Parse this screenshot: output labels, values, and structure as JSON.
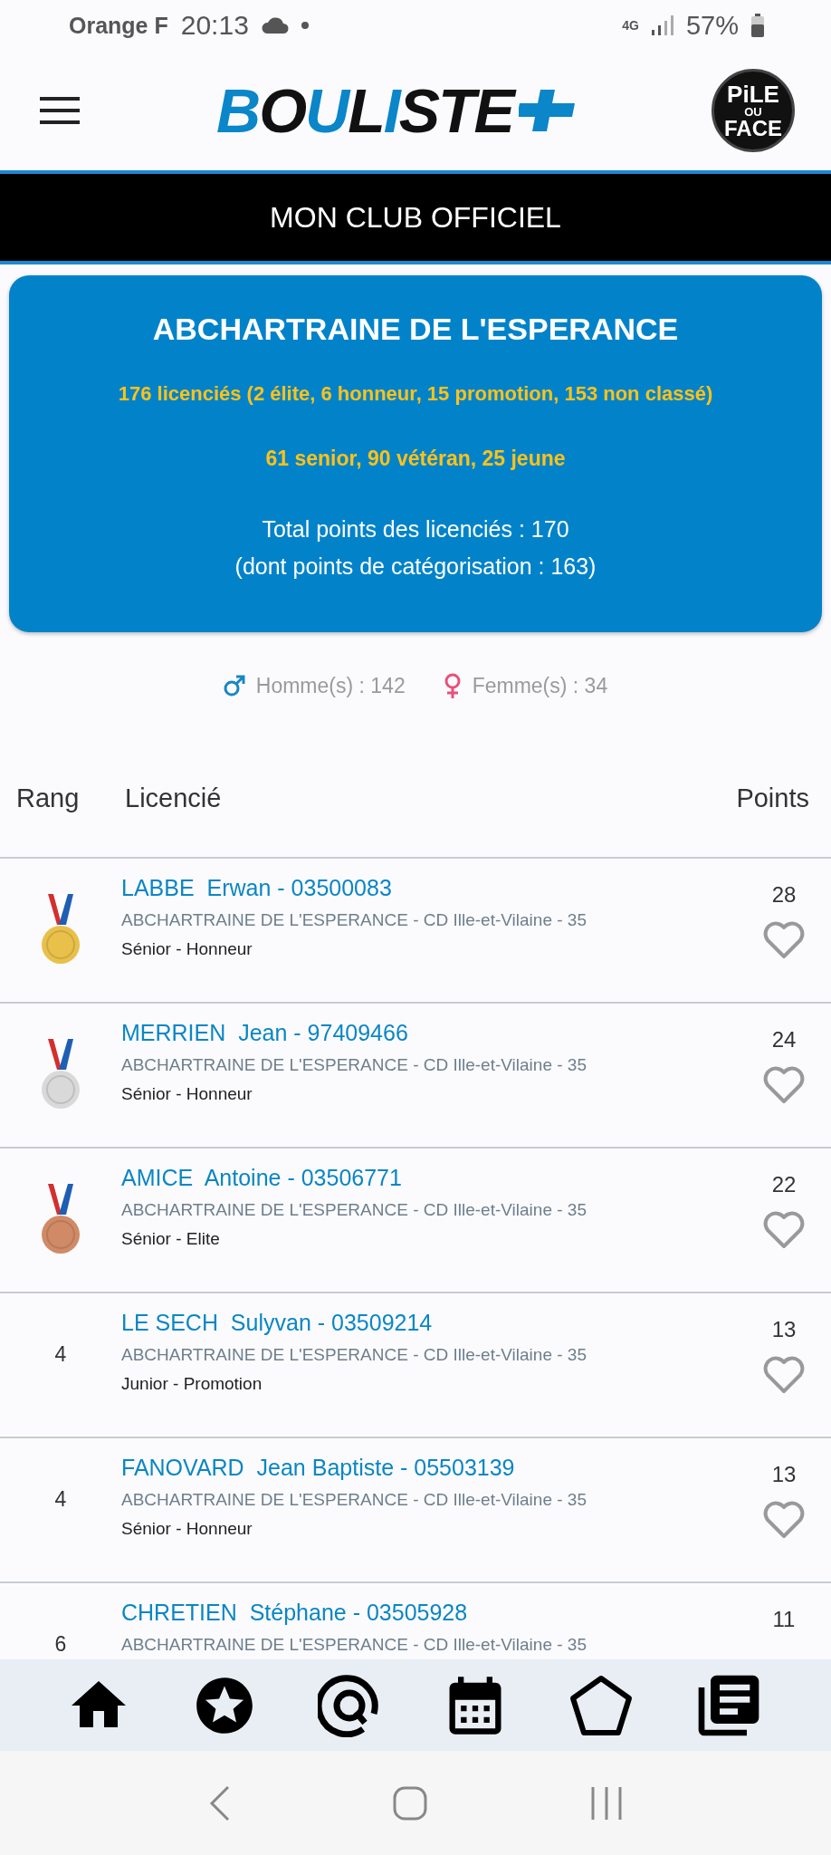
{
  "status_bar": {
    "carrier": "Orange F",
    "time": "20:13",
    "network": "4G",
    "battery": "57%"
  },
  "header": {
    "logo": "BOULISTE",
    "partner_logo": [
      "PiLE",
      "OU",
      "FACE"
    ]
  },
  "title_bar": "MON CLUB OFFICIEL",
  "club": {
    "name": "ABCHARTRAINE DE L'ESPERANCE",
    "licences": "176 licenciés (2 élite, 6 honneur, 15 promotion, 153 non classé)",
    "ages": "61 senior, 90 vétéran, 25 jeune",
    "total_points": "Total points des licenciés : 170",
    "categorisation_points": "(dont points de catégorisation : 163)"
  },
  "gender": {
    "men": "Homme(s) : 142",
    "women": "Femme(s) : 34"
  },
  "table": {
    "columns": [
      "Rang",
      "Licencié",
      "Points"
    ],
    "rows": [
      {
        "kind": "medal",
        "color": "#e8c04a",
        "name": "LABBE  Erwan - 03500083",
        "club": "ABCHARTRAINE DE L'ESPERANCE - CD Ille-et-Vilaine - 35",
        "category": "Sénior - Honneur",
        "points": "28",
        "favorite": false
      },
      {
        "kind": "medal",
        "color": "#d9d9d9",
        "name": "MERRIEN  Jean - 97409466",
        "club": "ABCHARTRAINE DE L'ESPERANCE - CD Ille-et-Vilaine - 35",
        "category": "Sénior - Honneur",
        "points": "24",
        "favorite": false
      },
      {
        "kind": "medal",
        "color": "#d08a66",
        "name": "AMICE  Antoine - 03506771",
        "club": "ABCHARTRAINE DE L'ESPERANCE - CD Ille-et-Vilaine - 35",
        "category": "Sénior - Elite",
        "points": "22",
        "favorite": false
      },
      {
        "kind": "rank",
        "rank": "4",
        "name": "LE SECH  Sulyvan - 03509214",
        "club": "ABCHARTRAINE DE L'ESPERANCE - CD Ille-et-Vilaine - 35",
        "category": "Junior - Promotion",
        "points": "13",
        "favorite": false
      },
      {
        "kind": "rank",
        "rank": "4",
        "name": "FANOVARD  Jean Baptiste - 05503139",
        "club": "ABCHARTRAINE DE L'ESPERANCE - CD Ille-et-Vilaine - 35",
        "category": "Sénior - Honneur",
        "points": "13",
        "favorite": false
      },
      {
        "kind": "rank",
        "rank": "6",
        "name": "CHRETIEN  Stéphane - 03505928",
        "club": "ABCHARTRAINE DE L'ESPERANCE - CD Ille-et-Vilaine - 35",
        "points": "11"
      }
    ]
  }
}
